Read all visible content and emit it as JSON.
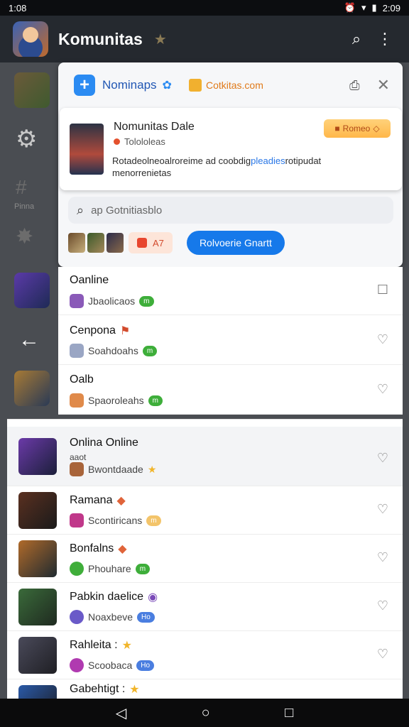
{
  "status": {
    "time": "1:08",
    "clock": "2:09"
  },
  "appbar": {
    "title": "Komunitas",
    "star": "★",
    "search_icon": "⌕",
    "menu_icon": "⋮"
  },
  "panel": {
    "brand_name": "Nominaps",
    "site_name": "Cotkitas.com",
    "popup": {
      "title": "Nomunitas Dale",
      "subtitle": "Tolololeas",
      "desc_before": "Rotadeolneoalroreime ad coobdig",
      "desc_highlight": "pleadies",
      "desc_after": "rotipudat menorrenietas",
      "button": "Romeo"
    },
    "search_placeholder": "ap Gotnitiasblo",
    "count_chip": "A7",
    "primary_button": "Rolvoerie Gnartt"
  },
  "list_top": [
    {
      "name": "Oanline",
      "meta": "Jbaolicaos",
      "tag": "m"
    },
    {
      "name": "Cenpona",
      "meta": "Soahdoahs",
      "tag": "m"
    },
    {
      "name": "Oalb",
      "meta": "Spaoroleahs",
      "tag": "m"
    }
  ],
  "list_bottom": [
    {
      "name": "Onlina Online",
      "meta_top": "aaot",
      "meta": "Bwontdaade"
    },
    {
      "name": "Ramana",
      "meta": "Scontiricans",
      "tag": "m"
    },
    {
      "name": "Bonfalns",
      "meta": "Phouhare",
      "tag": "m"
    },
    {
      "name": "Pabkin daelice",
      "meta": "Noaxbeve",
      "tag": "Ho"
    },
    {
      "name": "Rahleita :",
      "meta": "Scoobaca",
      "tag": "Ho"
    },
    {
      "name": "Gabehtigt :",
      "meta": ""
    }
  ],
  "colors": {
    "accent": "#1679ea",
    "tag_green": "#3eae3a",
    "tag_blue": "#4a7ee0",
    "highlight_text": "#2a77e6"
  }
}
